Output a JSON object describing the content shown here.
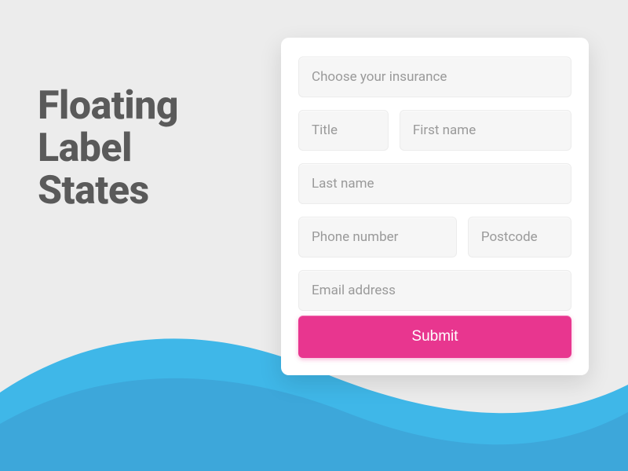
{
  "heading": {
    "line1": "Floating",
    "line2": "Label",
    "line3": "States"
  },
  "form": {
    "insurance": {
      "placeholder": "Choose your insurance"
    },
    "title": {
      "placeholder": "Title"
    },
    "first_name": {
      "placeholder": "First name"
    },
    "last_name": {
      "placeholder": "Last name"
    },
    "phone": {
      "placeholder": "Phone number"
    },
    "postcode": {
      "placeholder": "Postcode"
    },
    "email": {
      "placeholder": "Email address"
    },
    "submit_label": "Submit"
  },
  "colors": {
    "accent": "#e8368f",
    "wave_back": "#3fb7e8",
    "wave_front": "#3da7da",
    "background": "#ececec"
  }
}
